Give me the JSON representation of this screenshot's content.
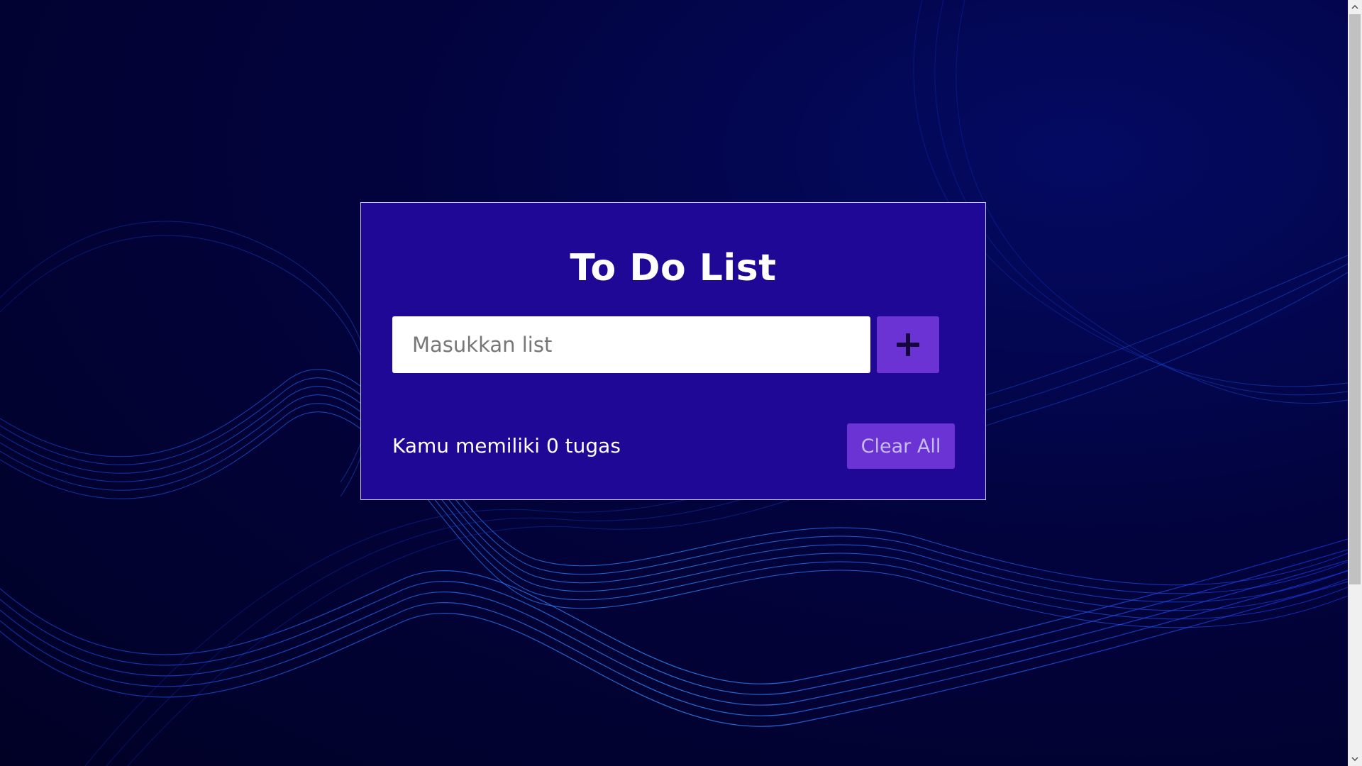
{
  "app": {
    "title": "To Do List"
  },
  "input": {
    "placeholder": "Masukkan list",
    "value": ""
  },
  "add_button": {
    "icon": "plus-icon"
  },
  "footer": {
    "task_count_text": "Kamu memiliki 0 tugas",
    "clear_label": "Clear All"
  },
  "colors": {
    "card_background": "#1e0895",
    "button_background": "#6b33d4",
    "page_background": "#02033d"
  }
}
